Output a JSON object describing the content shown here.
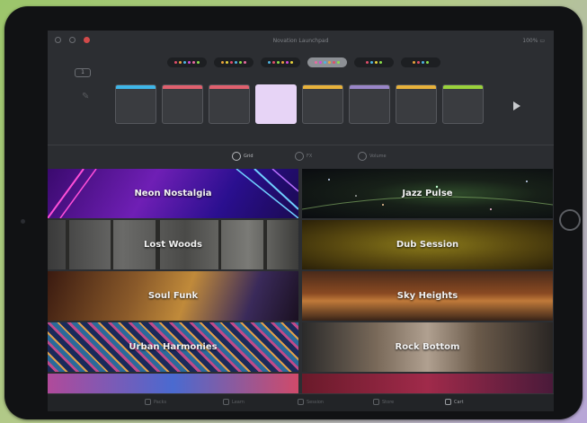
{
  "status_bar": {
    "center_text": "Novation Launchpad",
    "right_text": "100% ▭"
  },
  "badge_label": "1",
  "presets": [
    {
      "dots": [
        "#e04d6a",
        "#e8a33b",
        "#4fb3e0",
        "#d24ad8",
        "#e86aa0",
        "#8be04a"
      ],
      "active": false
    },
    {
      "dots": [
        "#e8a33b",
        "#e8d23b",
        "#e04d6a",
        "#4fb3e0",
        "#8be04a",
        "#e86aa0"
      ],
      "active": false
    },
    {
      "dots": [
        "#4fb3e0",
        "#e04d6a",
        "#8be04a",
        "#e8a33b",
        "#d24ad8",
        "#e8d23b"
      ],
      "active": false
    },
    {
      "dots": [
        "#e86aa0",
        "#d24ad8",
        "#4fb3e0",
        "#e8a33b",
        "#e04d6a",
        "#8be04a"
      ],
      "active": true
    },
    {
      "dots": [
        "#e04d6a",
        "#4fb3e0",
        "#e8d23b",
        "#8be04a"
      ],
      "active": false
    },
    {
      "dots": [
        "#e8a33b",
        "#e04d6a",
        "#4fb3e0",
        "#8be04a"
      ],
      "active": false
    }
  ],
  "pads": [
    {
      "label": "",
      "color": "#3fb6e8",
      "selected": false
    },
    {
      "label": "",
      "color": "#e0606e",
      "selected": false
    },
    {
      "label": "",
      "color": "#e0606e",
      "selected": false
    },
    {
      "label": "",
      "color": "#e7d4f6",
      "selected": true
    },
    {
      "label": "",
      "color": "#e8b23b",
      "selected": false
    },
    {
      "label": "",
      "color": "#9a86c8",
      "selected": false
    },
    {
      "label": "",
      "color": "#e8b23b",
      "selected": false
    },
    {
      "label": "",
      "color": "#9ad23b",
      "selected": false
    }
  ],
  "modes": [
    {
      "label": "Grid",
      "active": true
    },
    {
      "label": "FX",
      "active": false
    },
    {
      "label": "Volume",
      "active": false
    }
  ],
  "tiles": [
    {
      "name": "Neon Nostalgia",
      "theme": "neon"
    },
    {
      "name": "Jazz Pulse",
      "theme": "space"
    },
    {
      "name": "Lost Woods",
      "theme": "woods"
    },
    {
      "name": "Dub Session",
      "theme": "gold"
    },
    {
      "name": "Soul Funk",
      "theme": "soul"
    },
    {
      "name": "Sky Heights",
      "theme": "sky"
    },
    {
      "name": "Urban Harmonies",
      "theme": "urban"
    },
    {
      "name": "Rock Bottom",
      "theme": "rock"
    },
    {
      "name": "",
      "theme": "partial1"
    },
    {
      "name": "",
      "theme": "partial2"
    }
  ],
  "tabs": [
    {
      "label": "Packs",
      "icon": "pack-icon",
      "active": false
    },
    {
      "label": "Learn",
      "icon": "learn-icon",
      "active": false
    },
    {
      "label": "Session",
      "icon": "session-icon",
      "active": false
    },
    {
      "label": "Store",
      "icon": "store-icon",
      "active": false
    },
    {
      "label": "Cart",
      "icon": "cart-icon",
      "active": true
    }
  ]
}
